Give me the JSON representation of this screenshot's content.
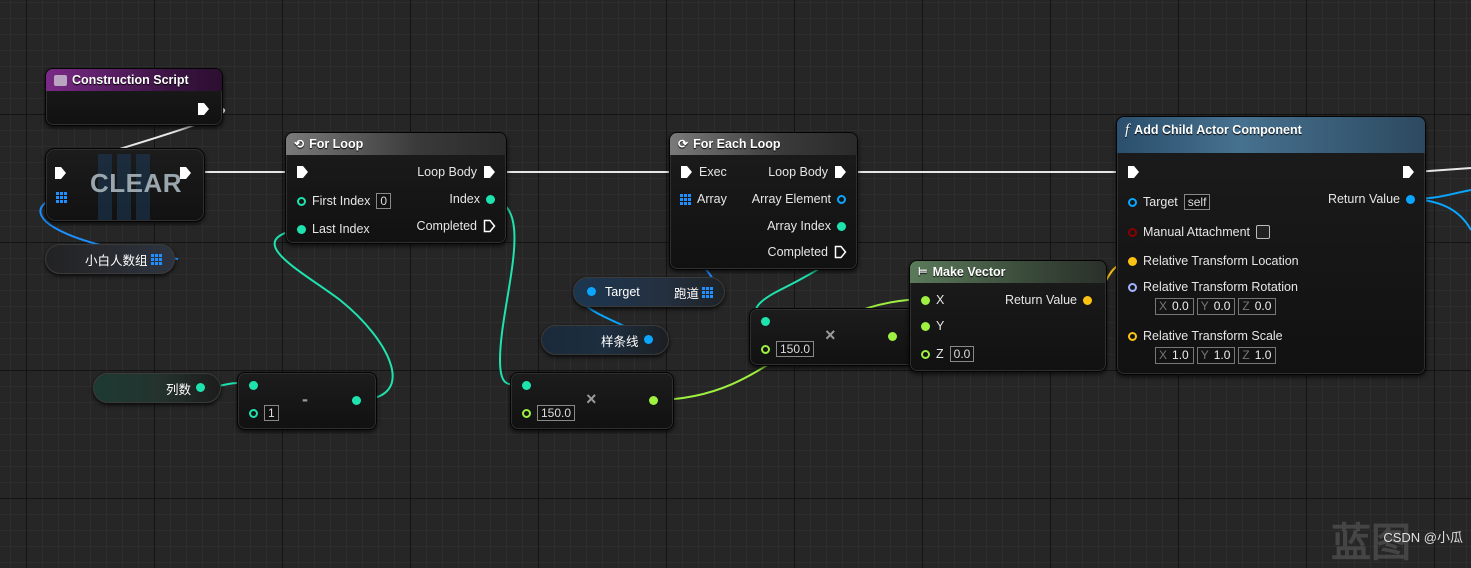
{
  "colors": {
    "exec": "#ffffff",
    "integer": "#1fe3af",
    "float": "#9ef041",
    "object": "#0aa6ff",
    "vector": "#fcc312",
    "rotator": "#a0b4ff",
    "bool": "#8c0000",
    "array": "#1e90ff"
  },
  "construction_script": {
    "title": "Construction Script"
  },
  "clear_node": {
    "label": "CLEAR"
  },
  "var_array": {
    "label": "小白人数组"
  },
  "var_target": {
    "label": "Target",
    "sublabel": "跑道"
  },
  "var_spline": {
    "label": "样条线"
  },
  "var_columns": {
    "label": "列数"
  },
  "subtract_node": {
    "operator": "-",
    "b_value": "1"
  },
  "for_loop": {
    "title": "For Loop",
    "first_index_label": "First Index",
    "first_index_value": "0",
    "last_index_label": "Last Index",
    "loop_body_label": "Loop Body",
    "index_label": "Index",
    "completed_label": "Completed"
  },
  "multiply_node_1": {
    "operator": "×",
    "b_value": "150.0"
  },
  "for_each_loop": {
    "title": "For Each Loop",
    "exec_label": "Exec",
    "array_label": "Array",
    "loop_body_label": "Loop Body",
    "array_element_label": "Array Element",
    "array_index_label": "Array Index",
    "completed_label": "Completed"
  },
  "multiply_node_2": {
    "operator": "×",
    "b_value": "150.0"
  },
  "make_vector": {
    "title": "Make Vector",
    "x_label": "X",
    "y_label": "Y",
    "z_label": "Z",
    "z_value": "0.0",
    "return_label": "Return Value"
  },
  "add_child_actor": {
    "title": "Add Child Actor Component",
    "target_label": "Target",
    "target_value": "self",
    "return_label": "Return Value",
    "manual_attachment_label": "Manual Attachment",
    "location_label": "Relative Transform Location",
    "rotation_label": "Relative Transform Rotation",
    "rotation": {
      "x": "0.0",
      "y": "0.0",
      "z": "0.0"
    },
    "scale_label": "Relative Transform Scale",
    "scale": {
      "x": "1.0",
      "y": "1.0",
      "z": "1.0"
    },
    "axis_x": "X",
    "axis_y": "Y",
    "axis_z": "Z"
  },
  "watermark": {
    "text": "CSDN @小瓜",
    "big_text": "蓝图"
  }
}
